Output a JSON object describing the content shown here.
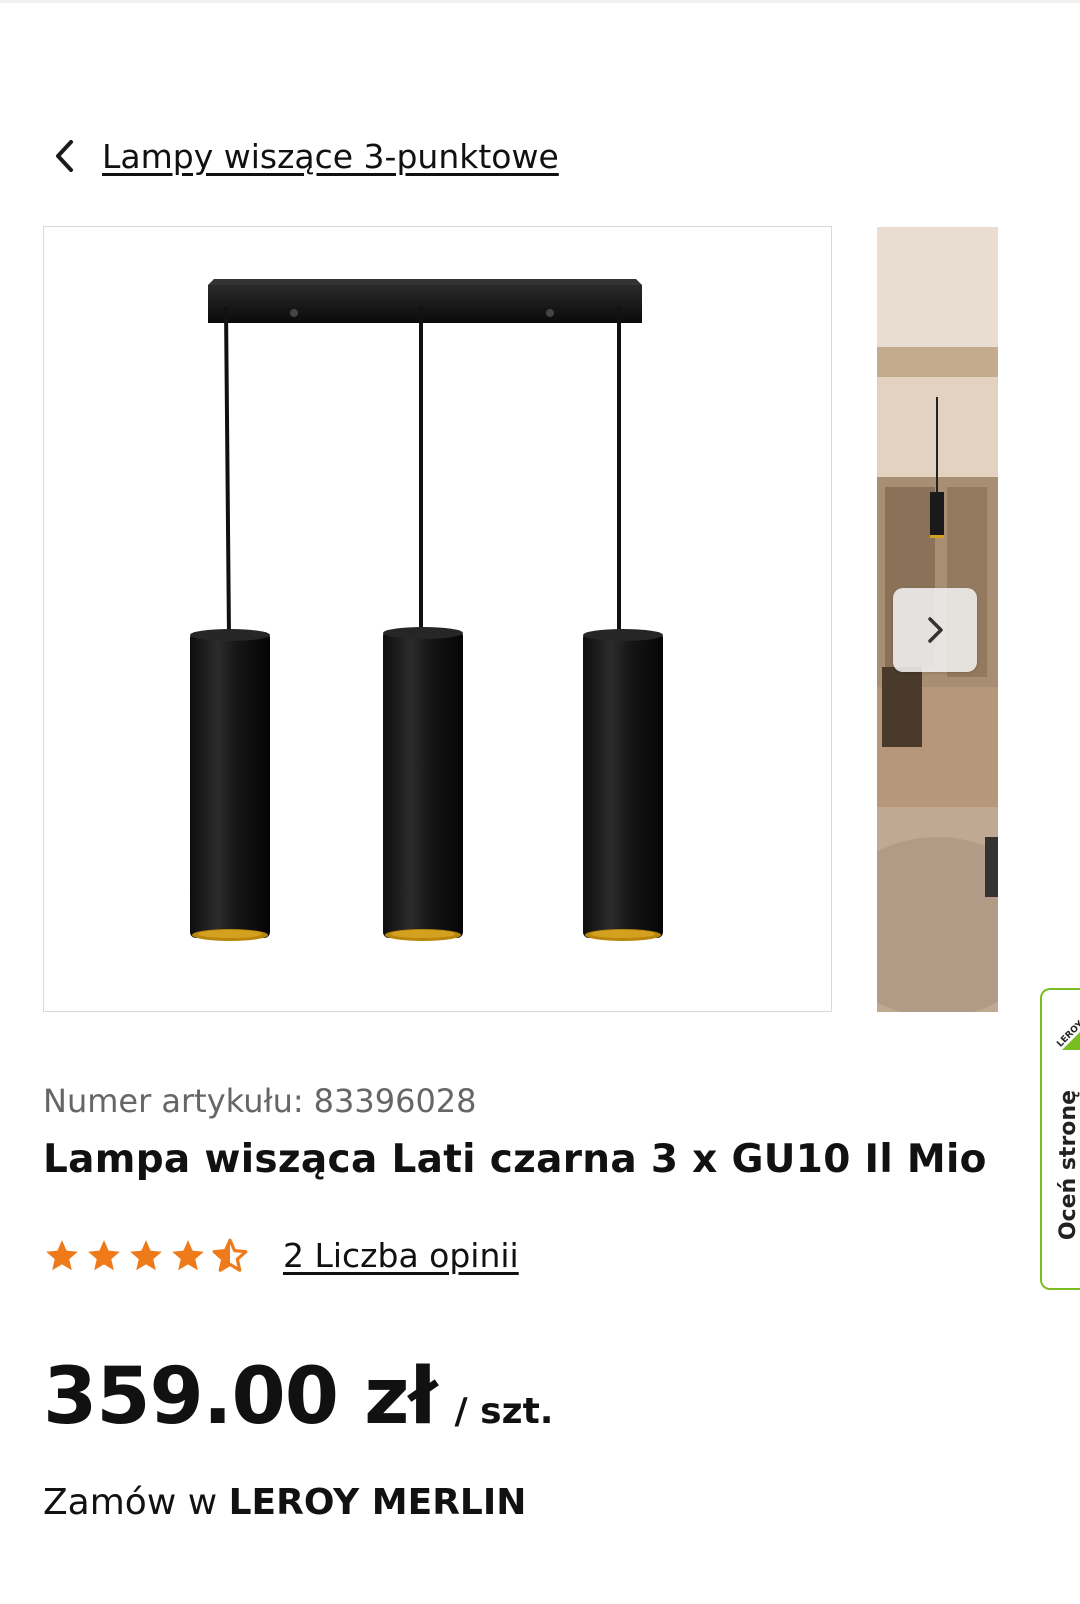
{
  "breadcrumb": {
    "label": "Lampy wiszące 3-punktowe"
  },
  "product": {
    "article_label": "Numer artykułu:",
    "article_number": "83396028",
    "title": "Lampa wisząca Lati czarna 3 x GU10 Il Mio",
    "rating": {
      "value": 4.5,
      "max": 5,
      "reviews_label": "2 Liczba opinii"
    },
    "price": "359.00 zł",
    "unit": "/ szt.",
    "order_prefix": "Zamów w",
    "order_store": "LEROY MERLIN"
  },
  "side_tab": {
    "logo_text": "LEROY",
    "label": "Oceń stronę"
  },
  "colors": {
    "star": "#ee7a1a",
    "brand_green": "#78be20",
    "text": "#111111",
    "muted": "#666666"
  },
  "icons": {
    "back": "chevron-left-icon",
    "next": "chevron-right-icon",
    "star": "star-icon"
  }
}
